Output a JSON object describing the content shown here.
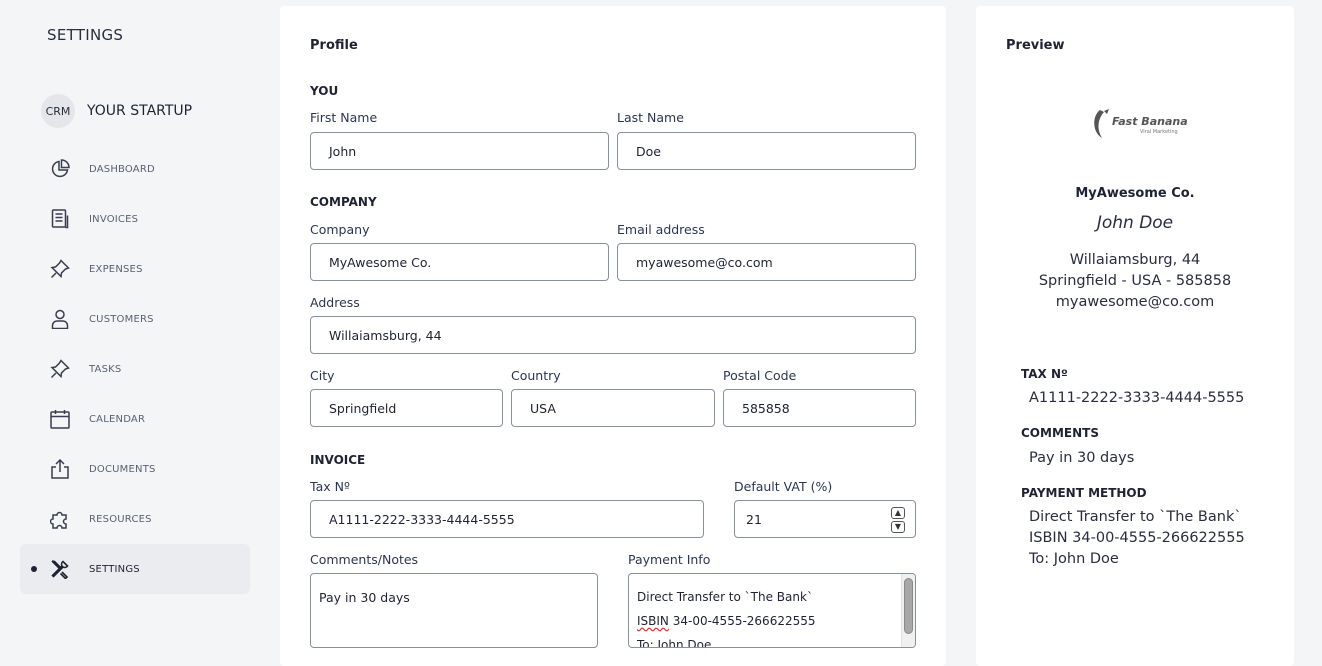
{
  "sidebar": {
    "title": "SETTINGS",
    "brand": {
      "badge": "CRM",
      "name": "YOUR STARTUP"
    },
    "items": [
      {
        "label": "DASHBOARD",
        "icon": "pie-chart-icon"
      },
      {
        "label": "INVOICES",
        "icon": "document-list-icon"
      },
      {
        "label": "EXPENSES",
        "icon": "pin-icon"
      },
      {
        "label": "CUSTOMERS",
        "icon": "user-icon"
      },
      {
        "label": "TASKS",
        "icon": "pin-icon"
      },
      {
        "label": "CALENDAR",
        "icon": "calendar-icon"
      },
      {
        "label": "DOCUMENTS",
        "icon": "share-upload-icon"
      },
      {
        "label": "RESOURCES",
        "icon": "puzzle-icon"
      },
      {
        "label": "SETTINGS",
        "icon": "tools-icon",
        "active": true
      }
    ]
  },
  "profile": {
    "title": "Profile",
    "you": {
      "heading": "YOU",
      "first_name_label": "First Name",
      "first_name": "John",
      "last_name_label": "Last Name",
      "last_name": "Doe"
    },
    "company": {
      "heading": "COMPANY",
      "company_label": "Company",
      "company": "MyAwesome Co.",
      "email_label": "Email address",
      "email": "myawesome@co.com",
      "address_label": "Address",
      "address": "Willaiamsburg, 44",
      "city_label": "City",
      "city": "Springfield",
      "country_label": "Country",
      "country": "USA",
      "postal_label": "Postal Code",
      "postal": "585858"
    },
    "invoice": {
      "heading": "INVOICE",
      "tax_label": "Tax Nº",
      "tax": "A1111-2222-3333-4444-5555",
      "vat_label": "Default VAT (%)",
      "vat": "21",
      "comments_label": "Comments/Notes",
      "comments": "Pay in 30 days",
      "payment_label": "Payment Info",
      "payment_lines": [
        "Direct Transfer to `The Bank`",
        "ISBIN 34-00-4555-266622555",
        "To: John Doe"
      ]
    }
  },
  "preview": {
    "title": "Preview",
    "logo_text": "Fast Banana",
    "logo_subtext": "Viral Marketing",
    "company": "MyAwesome Co.",
    "name": "John Doe",
    "address_lines": [
      "Willaiamsburg, 44",
      "Springfield - USA - 585858",
      "myawesome@co.com"
    ],
    "tax_heading": "TAX Nº",
    "tax": "A1111-2222-3333-4444-5555",
    "comments_heading": "COMMENTS",
    "comments": "Pay in 30 days",
    "payment_heading": "PAYMENT METHOD",
    "payment_lines": [
      "Direct Transfer to `The Bank`",
      "ISBIN 34-00-4555-266622555",
      "To: John Doe"
    ]
  }
}
